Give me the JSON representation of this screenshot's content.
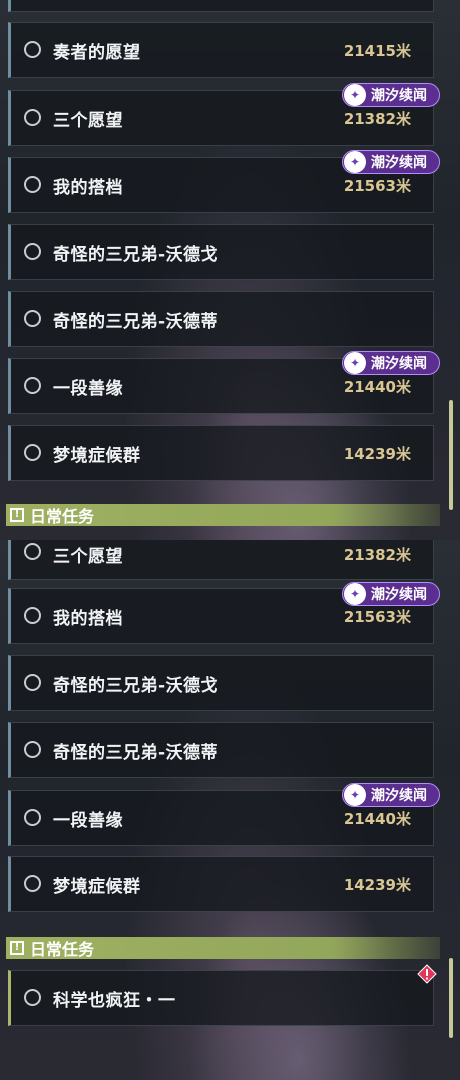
{
  "view1": {
    "quests": [
      {
        "name": "奏者的愿望",
        "distance": "21415米",
        "tag": null
      },
      {
        "name": "三个愿望",
        "distance": "21382米",
        "tag": "潮汐续闻"
      },
      {
        "name": "我的搭档",
        "distance": "21563米",
        "tag": "潮汐续闻"
      },
      {
        "name": "奇怪的三兄弟-沃德戈",
        "distance": "",
        "tag": null
      },
      {
        "name": "奇怪的三兄弟-沃德蒂",
        "distance": "",
        "tag": null
      },
      {
        "name": "一段善缘",
        "distance": "21440米",
        "tag": "潮汐续闻"
      },
      {
        "name": "梦境症候群",
        "distance": "14239米",
        "tag": null
      }
    ],
    "section_header": "日常任务"
  },
  "view2": {
    "quests": [
      {
        "name": "三个愿望",
        "distance": "21382米",
        "tag": null
      },
      {
        "name": "我的搭档",
        "distance": "21563米",
        "tag": "潮汐续闻"
      },
      {
        "name": "奇怪的三兄弟-沃德戈",
        "distance": "",
        "tag": null
      },
      {
        "name": "奇怪的三兄弟-沃德蒂",
        "distance": "",
        "tag": null
      },
      {
        "name": "一段善缘",
        "distance": "21440米",
        "tag": "潮汐续闻"
      },
      {
        "name": "梦境症候群",
        "distance": "14239米",
        "tag": null
      }
    ],
    "section_header": "日常任务",
    "daily_quests": [
      {
        "name": "科学也疯狂・一"
      }
    ]
  },
  "icons": {
    "radio": "radio-circle-icon",
    "tag": "tide-swirl-icon",
    "section": "exclamation-box-icon",
    "warning": "diamond-warning-icon"
  },
  "colors": {
    "tag_bg": "#5b2f8f",
    "distance_text": "#d8c693",
    "daily_accent": "#a9b86a",
    "warning": "#e0365a"
  }
}
